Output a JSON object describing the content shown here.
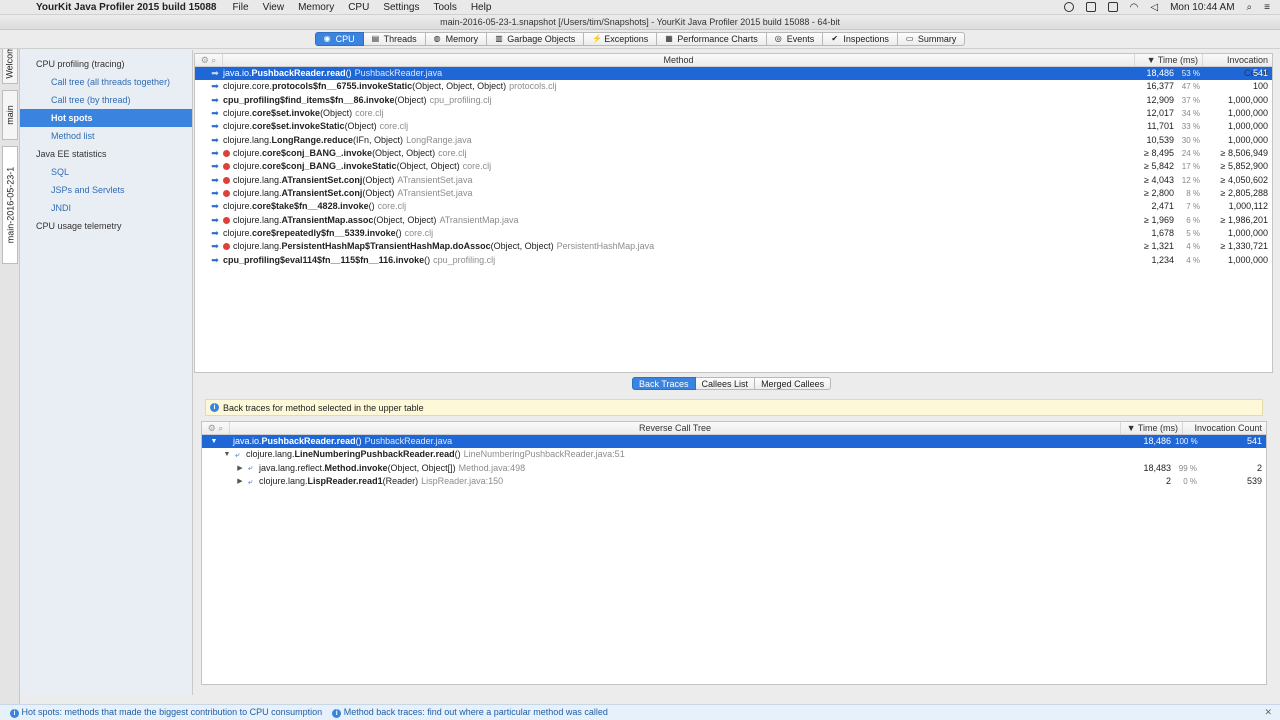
{
  "menubar": {
    "app_name": "YourKit Java Profiler 2015 build 15088",
    "menus": [
      "File",
      "View",
      "Memory",
      "CPU",
      "Settings",
      "Tools",
      "Help"
    ],
    "clock": "Mon 10:44 AM"
  },
  "window": {
    "title": "main-2016-05-23-1.snapshot [/Users/tim/Snapshots] - YourKit Java Profiler 2015 build 15088 - 64-bit"
  },
  "tabs": [
    {
      "label": "CPU",
      "icon": "cpu-icon"
    },
    {
      "label": "Threads",
      "icon": "threads-icon"
    },
    {
      "label": "Memory",
      "icon": "memory-icon"
    },
    {
      "label": "Garbage Objects",
      "icon": "garbage-icon"
    },
    {
      "label": "Exceptions",
      "icon": "lightning-icon"
    },
    {
      "label": "Performance Charts",
      "icon": "chart-icon"
    },
    {
      "label": "Events",
      "icon": "eye-icon"
    },
    {
      "label": "Inspections",
      "icon": "check-icon"
    },
    {
      "label": "Summary",
      "icon": "document-icon"
    }
  ],
  "vertical_tabs": [
    "Welcome",
    "main",
    "main-2016-05-23-1"
  ],
  "sidebar": {
    "items": [
      {
        "label": "CPU profiling (tracing)",
        "sub": false
      },
      {
        "label": "Call tree (all threads together)",
        "sub": true
      },
      {
        "label": "Call tree (by thread)",
        "sub": true
      },
      {
        "label": "Hot spots",
        "sub": true,
        "active": true
      },
      {
        "label": "Method list",
        "sub": true
      },
      {
        "label": "Java EE statistics",
        "sub": false
      },
      {
        "label": "SQL",
        "sub": true
      },
      {
        "label": "JSPs and Servlets",
        "sub": true
      },
      {
        "label": "JNDI",
        "sub": true
      },
      {
        "label": "CPU usage telemetry",
        "sub": false
      }
    ]
  },
  "hotspots": {
    "headers": {
      "method": "Method",
      "time": "Time (ms)",
      "invocations": "Invocation Count"
    },
    "rows": [
      {
        "pkg": "java.io.",
        "name": "PushbackReader.read",
        "args": "()",
        "loc": "PushbackReader.java",
        "time": "18,486",
        "pct": "53 %",
        "inv": "541",
        "stop": false,
        "sel": true
      },
      {
        "pkg": "clojure.core.",
        "name": "protocols$fn__6755.invokeStatic",
        "args": "(Object, Object, Object)",
        "loc": "protocols.clj",
        "time": "16,377",
        "pct": "47 %",
        "inv": "100",
        "stop": false
      },
      {
        "pkg": "",
        "name": "cpu_profiling$find_items$fn__86.invoke",
        "args": "(Object)",
        "loc": "cpu_profiling.clj",
        "time": "12,909",
        "pct": "37 %",
        "inv": "1,000,000",
        "stop": false
      },
      {
        "pkg": "clojure.",
        "name": "core$set.invoke",
        "args": "(Object)",
        "loc": "core.clj",
        "time": "12,017",
        "pct": "34 %",
        "inv": "1,000,000",
        "stop": false
      },
      {
        "pkg": "clojure.",
        "name": "core$set.invokeStatic",
        "args": "(Object)",
        "loc": "core.clj",
        "time": "11,701",
        "pct": "33 %",
        "inv": "1,000,000",
        "stop": false
      },
      {
        "pkg": "clojure.lang.",
        "name": "LongRange.reduce",
        "args": "(IFn, Object)",
        "loc": "LongRange.java",
        "time": "10,539",
        "pct": "30 %",
        "inv": "1,000,000",
        "stop": false
      },
      {
        "pkg": "clojure.",
        "name": "core$conj_BANG_.invoke",
        "args": "(Object, Object)",
        "loc": "core.clj",
        "time": "≥ 8,495",
        "pct": "24 %",
        "inv": "≥ 8,506,949",
        "stop": true
      },
      {
        "pkg": "clojure.",
        "name": "core$conj_BANG_.invokeStatic",
        "args": "(Object, Object)",
        "loc": "core.clj",
        "time": "≥ 5,842",
        "pct": "17 %",
        "inv": "≥ 5,852,900",
        "stop": true
      },
      {
        "pkg": "clojure.lang.",
        "name": "ATransientSet.conj",
        "args": "(Object)",
        "loc": "ATransientSet.java",
        "time": "≥ 4,043",
        "pct": "12 %",
        "inv": "≥ 4,050,602",
        "stop": true
      },
      {
        "pkg": "clojure.lang.",
        "name": "ATransientSet.conj",
        "args": "(Object)",
        "loc": "ATransientSet.java",
        "time": "≥ 2,800",
        "pct": "8 %",
        "inv": "≥ 2,805,288",
        "stop": true
      },
      {
        "pkg": "clojure.",
        "name": "core$take$fn__4828.invoke",
        "args": "()",
        "loc": "core.clj",
        "time": "2,471",
        "pct": "7 %",
        "inv": "1,000,112",
        "stop": false
      },
      {
        "pkg": "clojure.lang.",
        "name": "ATransientMap.assoc",
        "args": "(Object, Object)",
        "loc": "ATransientMap.java",
        "time": "≥ 1,969",
        "pct": "6 %",
        "inv": "≥ 1,986,201",
        "stop": true
      },
      {
        "pkg": "clojure.",
        "name": "core$repeatedly$fn__5339.invoke",
        "args": "()",
        "loc": "core.clj",
        "time": "1,678",
        "pct": "5 %",
        "inv": "1,000,000",
        "stop": false
      },
      {
        "pkg": "clojure.lang.",
        "name": "PersistentHashMap$TransientHashMap.doAssoc",
        "args": "(Object, Object)",
        "loc": "PersistentHashMap.java",
        "time": "≥ 1,321",
        "pct": "4 %",
        "inv": "≥ 1,330,721",
        "stop": true
      },
      {
        "pkg": "",
        "name": "cpu_profiling$eval114$fn__115$fn__116.invoke",
        "args": "()",
        "loc": "cpu_profiling.clj",
        "time": "1,234",
        "pct": "4 %",
        "inv": "1,000,000",
        "stop": false
      }
    ]
  },
  "lower_tabs": [
    "Back Traces",
    "Callees List",
    "Merged Callees"
  ],
  "info_text": "Back traces for method selected in the upper table",
  "backtraces": {
    "headers": {
      "method": "Reverse Call Tree",
      "time": "Time (ms)",
      "invocations": "Invocation Count"
    },
    "rows": [
      {
        "indent": 0,
        "twisty": "▼",
        "pkg": "java.io.",
        "name": "PushbackReader.read",
        "args": "()",
        "loc": "PushbackReader.java",
        "time": "18,486",
        "pct": "100 %",
        "inv": "541",
        "sel": true
      },
      {
        "indent": 1,
        "twisty": "▼",
        "pkg": "clojure.lang.",
        "name": "LineNumberingPushbackReader.read",
        "args": "()",
        "loc": "LineNumberingPushbackReader.java:51",
        "time": "",
        "pct": "",
        "inv": ""
      },
      {
        "indent": 2,
        "twisty": "▶",
        "pkg": "java.lang.reflect.",
        "name": "Method.invoke",
        "args": "(Object, Object[])",
        "loc": "Method.java:498",
        "time": "18,483",
        "pct": "99 %",
        "inv": "2"
      },
      {
        "indent": 2,
        "twisty": "▶",
        "pkg": "clojure.lang.",
        "name": "LispReader.read1",
        "args": "(Reader)",
        "loc": "LispReader.java:150",
        "time": "2",
        "pct": "0 %",
        "inv": "539"
      }
    ]
  },
  "status": {
    "left": "Hot spots: methods that made the biggest contribution to CPU consumption",
    "right": "Method back traces: find out where a particular method was called"
  }
}
